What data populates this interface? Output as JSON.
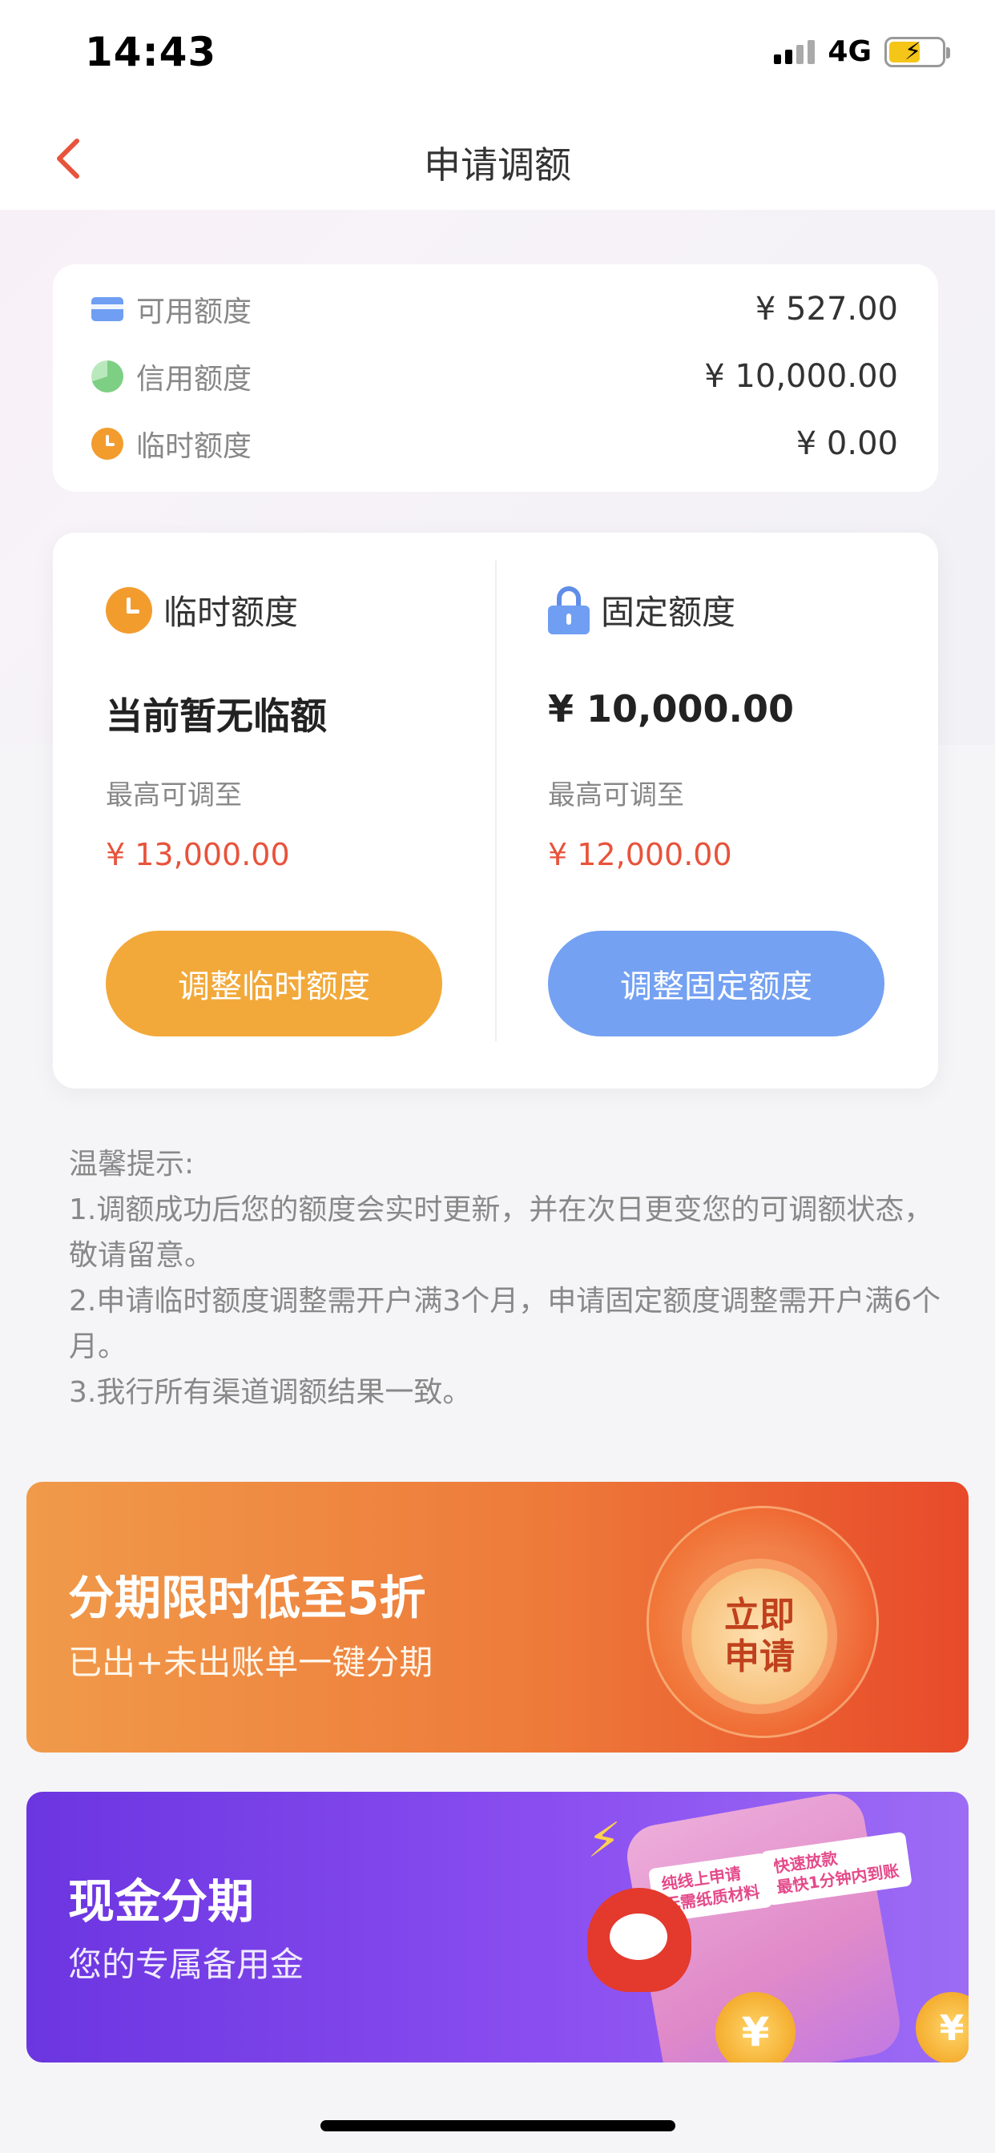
{
  "status_bar": {
    "time": "14:43",
    "network": "4G"
  },
  "nav": {
    "title": "申请调额",
    "back_icon": "chevron-left-icon"
  },
  "summary": {
    "rows": [
      {
        "icon": "card-icon",
        "label": "可用额度",
        "value": "¥ 527.00"
      },
      {
        "icon": "pie-icon",
        "label": "信用额度",
        "value": "¥ 10,000.00"
      },
      {
        "icon": "clock-icon",
        "label": "临时额度",
        "value": "¥ 0.00"
      }
    ]
  },
  "temp_col": {
    "title": "临时额度",
    "current": "当前暂无临额",
    "max_label": "最高可调至",
    "max_value": "¥ 13,000.00",
    "button": "调整临时额度"
  },
  "fixed_col": {
    "title": "固定额度",
    "current": "¥ 10,000.00",
    "max_label": "最高可调至",
    "max_value": "¥ 12,000.00",
    "button": "调整固定额度"
  },
  "tips": {
    "heading": "温馨提示:",
    "lines": [
      "1.调额成功后您的额度会实时更新，并在次日更变您的可调额状态，敬请留意。",
      "2.申请临时额度调整需开户满3个月，申请固定额度调整需开户满6个月。",
      "3.我行所有渠道调额结果一致。"
    ]
  },
  "banner1": {
    "title": "分期限时低至5折",
    "subtitle": "已出+未出账单一键分期",
    "badge_line1": "立即",
    "badge_line2": "申请"
  },
  "banner2": {
    "title": "现金分期",
    "subtitle": "您的专属备用金",
    "tag1_line1": "纯线上申请",
    "tag1_line2": "无需纸质材料",
    "tag2_line1": "快速放款",
    "tag2_line2": "最快1分钟内到账",
    "coin_symbol": "¥"
  },
  "colors": {
    "accent_red": "#e8533b",
    "orange_button": "#f2a93a",
    "blue_button": "#74a1f2"
  }
}
